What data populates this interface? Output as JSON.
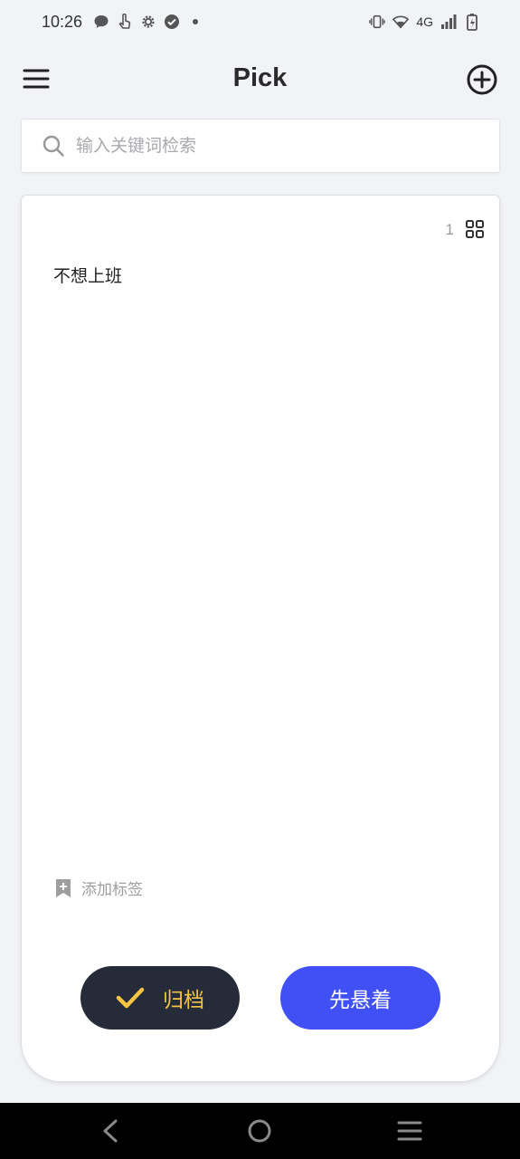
{
  "status_bar": {
    "time": "10:26",
    "left_icons": [
      "message-icon",
      "touch-icon",
      "settings-icon",
      "check-circle-icon",
      "dot-icon"
    ],
    "network": "4G",
    "right_icons": [
      "vibrate-icon",
      "wifi-icon",
      "signal-icon",
      "battery-charging-icon"
    ]
  },
  "app_bar": {
    "title": "Pick",
    "menu_icon": "menu-icon",
    "add_icon": "add-circle-icon"
  },
  "search": {
    "placeholder": "输入关键词检索",
    "value": ""
  },
  "card": {
    "count": "1",
    "text": "不想上班",
    "add_tag_label": "添加标签"
  },
  "actions": {
    "archive_label": "归档",
    "later_label": "先悬着"
  },
  "colors": {
    "background": "#f2f3f7",
    "archive_bg": "#262b3a",
    "archive_text": "#f5c542",
    "later_bg": "#4150f5"
  }
}
